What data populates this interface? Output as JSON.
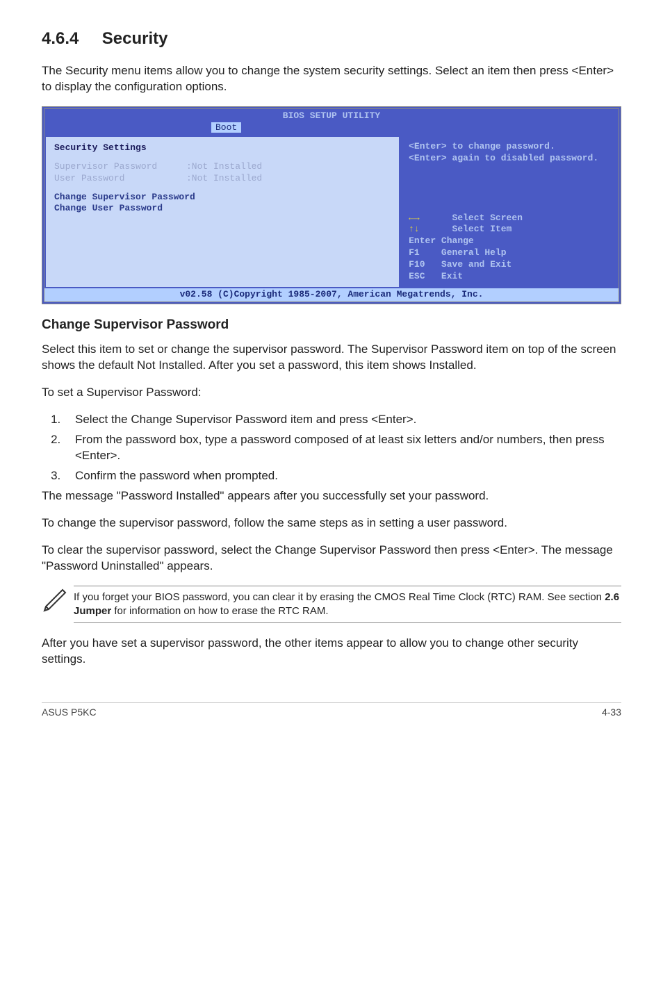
{
  "section": {
    "number": "4.6.4",
    "title": "Security"
  },
  "intro": "The Security menu items allow you to change the system security settings. Select an item then press <Enter> to display the configuration options.",
  "bios": {
    "title": "BIOS SETUP UTILITY",
    "tab": "Boot",
    "left": {
      "heading": "Security Settings",
      "row1_label": "Supervisor Password",
      "row1_value": ":Not Installed",
      "row2_label": "User Password",
      "row2_value": ":Not Installed",
      "item1": "Change Supervisor Password",
      "item2": "Change User Password"
    },
    "right": {
      "help1": "<Enter> to change password.",
      "help2": "<Enter> again to disabled password.",
      "k1": "      Select Screen",
      "k2": "      Select Item",
      "k3": "Enter Change",
      "k4": "F1    General Help",
      "k5": "F10   Save and Exit",
      "k6": "ESC   Exit"
    },
    "footer": "v02.58 (C)Copyright 1985-2007, American Megatrends, Inc."
  },
  "sub1": {
    "heading": "Change Supervisor Password",
    "p1": "Select this item to set or change the supervisor password. The Supervisor Password item on top of the screen shows the default Not Installed. After you set a password, this item shows Installed.",
    "p2": "To set a Supervisor Password:",
    "step1": "Select the Change Supervisor Password item and press <Enter>.",
    "step2": "From the password box, type a password composed of at least six letters and/or numbers, then press <Enter>.",
    "step3": "Confirm the password when prompted.",
    "p3": "The message \"Password Installed\" appears after you successfully set your password.",
    "p4": "To change the supervisor password, follow the same steps as in setting a user password.",
    "p5": "To clear the supervisor password, select the Change Supervisor Password then press <Enter>. The message \"Password Uninstalled\" appears."
  },
  "note": "If you forget your BIOS password, you can clear it by erasing the CMOS Real Time Clock (RTC) RAM. See section 2.6 Jumper for information on how to erase the RTC RAM.",
  "after_note": "After you have set a supervisor password, the other items appear to allow you to change other security settings.",
  "footer": {
    "left": "ASUS P5KC",
    "right": "4-33"
  }
}
